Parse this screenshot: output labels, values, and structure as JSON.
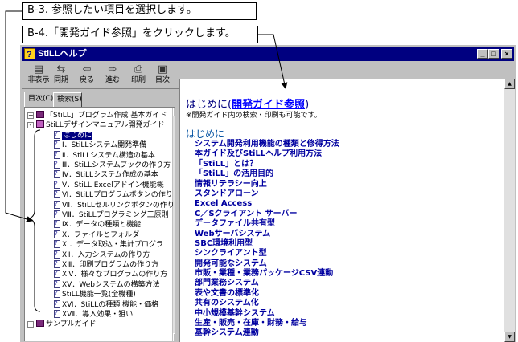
{
  "callouts": {
    "step3": "B-3. 参照したい項目を選択します。",
    "step4": "B-4.「開発ガイド参照」をクリックします。"
  },
  "window": {
    "title": "StiLLヘルプ",
    "buttons": {
      "minimize": "_",
      "maximize": "□",
      "close": "×"
    }
  },
  "toolbar": {
    "items": [
      {
        "label": "非表示",
        "icon": "hide-icon"
      },
      {
        "label": "同期",
        "icon": "sync-icon"
      },
      {
        "label": "戻る",
        "icon": "back-arrow-icon"
      },
      {
        "label": "進む",
        "icon": "forward-arrow-icon"
      },
      {
        "label": "印刷",
        "icon": "printer-icon"
      },
      {
        "label": "目次",
        "icon": "contents-icon"
      }
    ]
  },
  "tabs": {
    "contents": "目次(C)",
    "search": "検索(S)"
  },
  "tree": {
    "items": [
      {
        "text": "「StiLL」プログラム作成 基本ガイド",
        "type": "book-closed",
        "indent": 0,
        "expander": "+"
      },
      {
        "text": "StiLLデザインマニュアル開発ガイド",
        "type": "book-open",
        "indent": 0,
        "expander": "-"
      },
      {
        "text": "はじめに",
        "type": "page",
        "indent": 1,
        "selected": true
      },
      {
        "text": "Ⅰ．StiLLシステム開発準備",
        "type": "page",
        "indent": 1
      },
      {
        "text": "Ⅱ．StiLLシステム構造の基本",
        "type": "page",
        "indent": 1
      },
      {
        "text": "Ⅲ．StiLLシステムブックの作り方",
        "type": "page",
        "indent": 1
      },
      {
        "text": "Ⅳ．StiLLシステム作成の基本",
        "type": "page",
        "indent": 1
      },
      {
        "text": "Ⅴ．StiLL Excelアドイン機能概",
        "type": "page",
        "indent": 1
      },
      {
        "text": "Ⅵ．StiLLプログラムボタンの作り",
        "type": "page",
        "indent": 1
      },
      {
        "text": "Ⅶ．StiLLセルリンクボタンの作り",
        "type": "page",
        "indent": 1
      },
      {
        "text": "Ⅷ．StiLLプログラミング三原則",
        "type": "page",
        "indent": 1
      },
      {
        "text": "Ⅸ．データの種類と機能",
        "type": "page",
        "indent": 1
      },
      {
        "text": "Ⅹ．ファイルとフォルダ",
        "type": "page",
        "indent": 1
      },
      {
        "text": "ⅩⅠ．データ取込・集計プログラ",
        "type": "page",
        "indent": 1
      },
      {
        "text": "ⅩⅡ．入力システムの作り方",
        "type": "page",
        "indent": 1
      },
      {
        "text": "ⅩⅢ．印刷プログラムの作り方",
        "type": "page",
        "indent": 1
      },
      {
        "text": "ⅩⅣ．様々なプログラムの作り方",
        "type": "page",
        "indent": 1
      },
      {
        "text": "ⅩⅤ．Webシステムの構築方法",
        "type": "page",
        "indent": 1
      },
      {
        "text": "StiLL機能一覧(全機種)",
        "type": "page",
        "indent": 1
      },
      {
        "text": "ⅩⅥ．StiLLの種類 機能・価格",
        "type": "page",
        "indent": 1
      },
      {
        "text": "ⅩⅦ．導入効果・狙い",
        "type": "page",
        "indent": 1
      },
      {
        "text": "サンプルガイド",
        "type": "book-closed",
        "indent": 0,
        "expander": "+"
      }
    ]
  },
  "content": {
    "title_prefix": "はじめに(",
    "title_link": "開発ガイド参照",
    "title_suffix": ")",
    "note": "※開発ガイド内の検索・印刷も可能です。",
    "section_heading": "はじめに",
    "links": [
      "システム開発利用機能の種類と修得方法",
      "本ガイド及びStiLLヘルプ利用方法",
      "「StiLL」とは？",
      "「StiLL」の活用目的",
      "情報リテラシー向上",
      "スタンドアローン",
      "Excel Access",
      "C／Sクライアント サーバー",
      "データファイル共有型",
      "Webサーバシステム",
      "SBC環境利用型",
      "シンクライアント型",
      "開発可能なシステム",
      "市販・業種・業務パッケージCSV連動",
      "部門業務システム",
      "表や文書の標準化",
      "共有のシステム化",
      "中小規模基幹システム",
      "生産・販売・在庫・財務・給与",
      "基幹システム連動"
    ]
  }
}
